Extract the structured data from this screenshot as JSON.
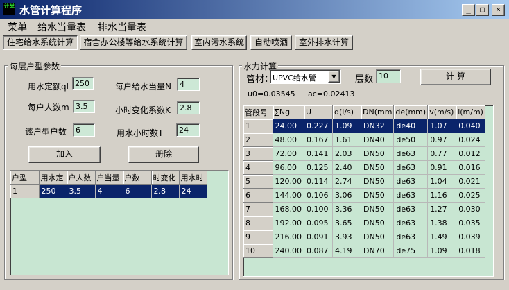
{
  "window": {
    "app_icon_text": "计算",
    "title": "水管计算程序",
    "minimize": "_",
    "maximize": "□",
    "close": "×"
  },
  "menu": [
    "菜单",
    "给水当量表",
    "排水当量表"
  ],
  "tabs": [
    "住宅给水系统计算",
    "宿舍办公楼等给水系统计算",
    "室内污水系统",
    "自动喷洒",
    "室外排水计算"
  ],
  "left": {
    "group_label": "每层户型参数",
    "fields": {
      "water_quota_label": "用水定额ql",
      "water_quota_value": "250",
      "persons_label": "每户人数m",
      "persons_value": "3.5",
      "households_label": "该户型户数",
      "households_value": "6",
      "equiv_label": "每户给水当量N",
      "equiv_value": "4",
      "hour_coef_label": "小时变化系数K",
      "hour_coef_value": "2.8",
      "hours_label": "用水小时数T",
      "hours_value": "24"
    },
    "add_button": "加入",
    "delete_button": "册除",
    "table": {
      "headers": [
        "户型",
        "用水定",
        "户人数",
        "户当量",
        "户数",
        "时变化",
        "用水时"
      ],
      "rows": [
        [
          "1",
          "250",
          "3.5",
          "4",
          "6",
          "2.8",
          "24"
        ]
      ]
    }
  },
  "right": {
    "group_label": "水力计算",
    "material_label": "管材：",
    "material_value": "UPVC给水管",
    "floors_label": "层数",
    "floors_value": "10",
    "calc_button": "计  算",
    "u0_text": "u0=0.03545",
    "ac_text": "ac=0.02413",
    "table": {
      "headers": [
        "管段号",
        "∑Ng",
        "U",
        "q(l/s)",
        "DN(mm",
        "de(mm)",
        "v(m/s)",
        "i(m/m)"
      ],
      "rows": [
        [
          "1",
          "24.00",
          "0.227",
          "1.09",
          "DN32",
          "de40",
          "1.07",
          "0.040"
        ],
        [
          "2",
          "48.00",
          "0.167",
          "1.61",
          "DN40",
          "de50",
          "0.97",
          "0.024"
        ],
        [
          "3",
          "72.00",
          "0.141",
          "2.03",
          "DN50",
          "de63",
          "0.77",
          "0.012"
        ],
        [
          "4",
          "96.00",
          "0.125",
          "2.40",
          "DN50",
          "de63",
          "0.91",
          "0.016"
        ],
        [
          "5",
          "120.00",
          "0.114",
          "2.74",
          "DN50",
          "de63",
          "1.04",
          "0.021"
        ],
        [
          "6",
          "144.00",
          "0.106",
          "3.06",
          "DN50",
          "de63",
          "1.16",
          "0.025"
        ],
        [
          "7",
          "168.00",
          "0.100",
          "3.36",
          "DN50",
          "de63",
          "1.27",
          "0.030"
        ],
        [
          "8",
          "192.00",
          "0.095",
          "3.65",
          "DN50",
          "de63",
          "1.38",
          "0.035"
        ],
        [
          "9",
          "216.00",
          "0.091",
          "3.93",
          "DN50",
          "de63",
          "1.49",
          "0.039"
        ],
        [
          "10",
          "240.00",
          "0.087",
          "4.19",
          "DN70",
          "de75",
          "1.09",
          "0.018"
        ]
      ]
    }
  }
}
